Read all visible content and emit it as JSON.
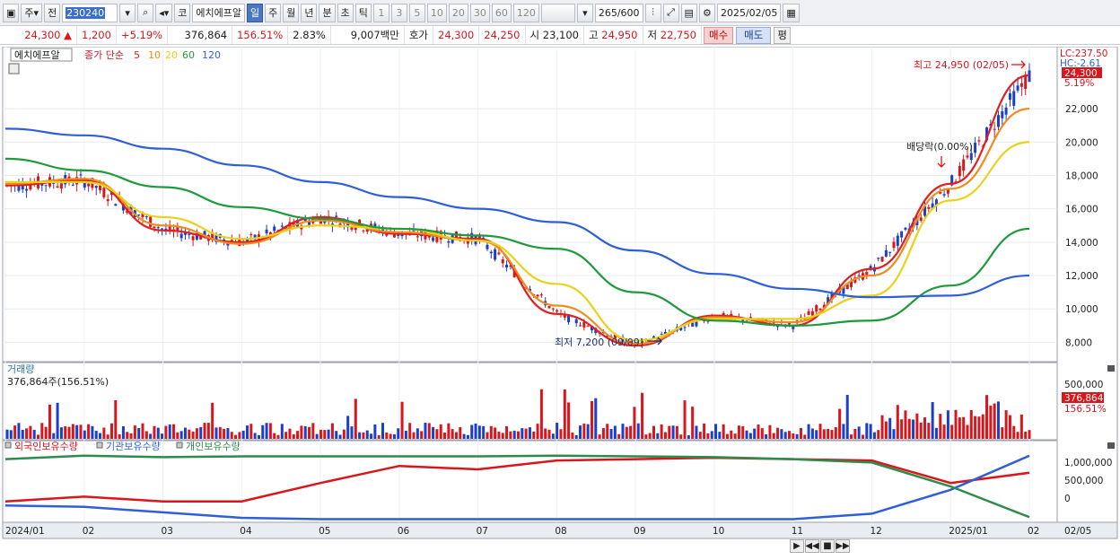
{
  "toolbar": {
    "market": "주",
    "type": "전",
    "code": "230240",
    "stock_name": "에치에프알",
    "code_prefix": "코",
    "periods": [
      "일",
      "주",
      "월",
      "년",
      "분",
      "초",
      "틱"
    ],
    "selected_period": "일",
    "intervals": [
      "1",
      "3",
      "5",
      "10",
      "20",
      "30",
      "60",
      "120"
    ],
    "count": "265",
    "count_total": "/600",
    "date": "2025/02/05"
  },
  "info": {
    "price": "24,300",
    "change_arrow": "▲",
    "change": "1,200",
    "change_pct": "+5.19%",
    "volume": "376,864",
    "volume_ratio": "156.51%",
    "turnover": "2.83%",
    "amount": "9,007백만",
    "quote_label": "호가",
    "ask": "24,300",
    "bid": "24,250",
    "open_label": "시",
    "open": "23,100",
    "high_label": "고",
    "high": "24,950",
    "low_label": "저",
    "low": "22,750",
    "buy": "매수",
    "sell": "매도",
    "avg": "평"
  },
  "price_panel": {
    "name": "에치에프알",
    "ma_label": "종가 단순",
    "ma_periods": [
      "5",
      "10",
      "20",
      "60",
      "120"
    ],
    "ma_colors": [
      "#e0201e",
      "#f08c1e",
      "#e8d21a",
      "#1f9a3a",
      "#2f5fd8"
    ],
    "lc": "LC:237.50",
    "hc": "HC:-2.61",
    "last_price": "24,300",
    "last_pct": "5.19%",
    "y_ticks": [
      "22,000",
      "20,000",
      "18,000",
      "16,000",
      "14,000",
      "12,000",
      "10,000",
      "8,000"
    ],
    "high_annotation": "최고 24,950 (02/05)",
    "low_annotation": "최저 7,200 (09/09)",
    "dividend_annotation": "배당락(0.00%)"
  },
  "volume_panel": {
    "title": "거래량",
    "summary": "376,864주(156.51%)",
    "y_tick": "500,000",
    "last_value": "376,864",
    "last_pct": "156.51%"
  },
  "holdings_panel": {
    "labels": [
      "외국인보유수량",
      "기관보유수량",
      "개인보유수량"
    ],
    "colors": [
      "#d8161c",
      "#2f5fd8",
      "#2e8b4a"
    ],
    "y_ticks": [
      "1,000,000",
      "500,000",
      "0"
    ]
  },
  "x_axis": {
    "labels": [
      "2024/01",
      "02",
      "03",
      "04",
      "05",
      "06",
      "07",
      "08",
      "09",
      "10",
      "11",
      "12",
      "2025/01",
      "02",
      "02/05"
    ]
  },
  "chart_data": {
    "type": "candlestick",
    "title": "",
    "x": [
      "2024/01",
      "02",
      "03",
      "04",
      "05",
      "06",
      "07",
      "08",
      "09",
      "10",
      "11",
      "12",
      "2025/01",
      "02"
    ],
    "series": [
      {
        "name": "5",
        "values": [
          17400,
          17700,
          14700,
          14000,
          15500,
          14500,
          14200,
          9700,
          7800,
          9600,
          9000,
          12400,
          17500,
          24000
        ]
      },
      {
        "name": "10",
        "values": [
          17500,
          17800,
          15000,
          13900,
          15300,
          14600,
          14100,
          10200,
          7900,
          9500,
          9200,
          12000,
          17200,
          22000
        ]
      },
      {
        "name": "20",
        "values": [
          17600,
          17600,
          15500,
          14200,
          15000,
          14800,
          14100,
          11500,
          8100,
          9400,
          9400,
          10800,
          16500,
          20000
        ]
      },
      {
        "name": "60",
        "values": [
          19000,
          18300,
          17300,
          16100,
          15400,
          14800,
          14400,
          13600,
          11000,
          9300,
          9000,
          9300,
          11400,
          14800
        ]
      },
      {
        "name": "120",
        "values": [
          20800,
          20400,
          19600,
          18600,
          17600,
          16700,
          16000,
          15200,
          13500,
          12100,
          11200,
          10700,
          10800,
          12000
        ]
      }
    ],
    "ylim": [
      7000,
      25500
    ],
    "high": {
      "value": 24950,
      "date": "02/05"
    },
    "low": {
      "value": 7200,
      "date": "09/09"
    }
  }
}
